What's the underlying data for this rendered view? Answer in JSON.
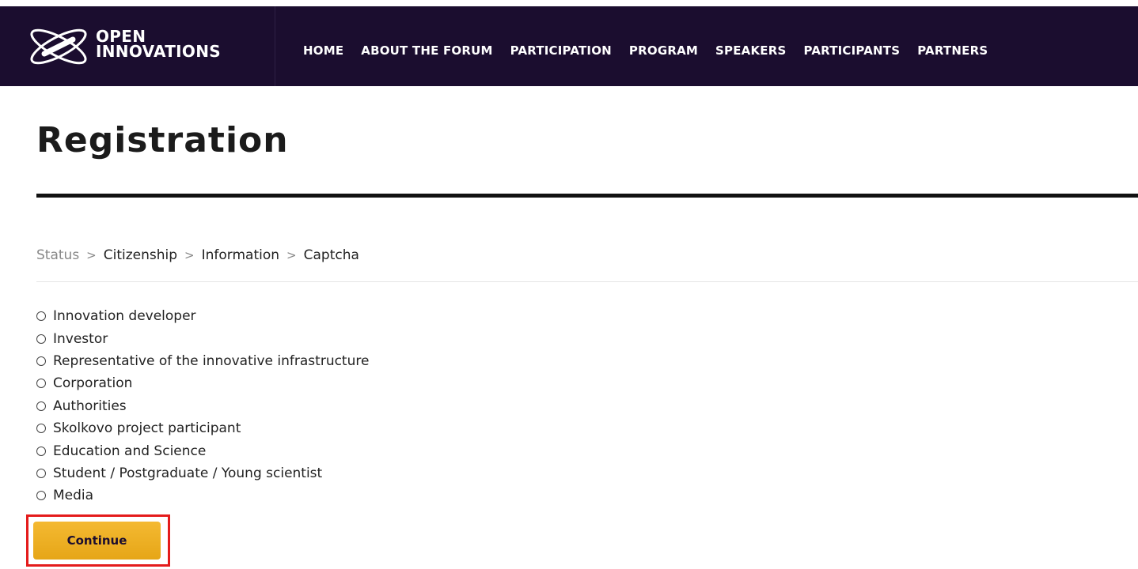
{
  "header": {
    "logo_line1": "OPEN",
    "logo_line2": "INNOVATIONS",
    "nav": [
      {
        "label": "HOME"
      },
      {
        "label": "ABOUT THE FORUM"
      },
      {
        "label": "PARTICIPATION"
      },
      {
        "label": "PROGRAM"
      },
      {
        "label": "SPEAKERS"
      },
      {
        "label": "PARTICIPANTS"
      },
      {
        "label": "PARTNERS"
      }
    ],
    "background_color": "#1b0d2f"
  },
  "page_title": "Registration",
  "breadcrumb": {
    "steps": [
      "Status",
      "Citizenship",
      "Information",
      "Captcha"
    ],
    "separator": ">"
  },
  "options": [
    {
      "label": "Innovation developer"
    },
    {
      "label": "Investor"
    },
    {
      "label": "Representative of the innovative infrastructure"
    },
    {
      "label": "Corporation"
    },
    {
      "label": "Authorities"
    },
    {
      "label": "Skolkovo project participant"
    },
    {
      "label": "Education and Science"
    },
    {
      "label": "Student / Postgraduate / Young scientist"
    },
    {
      "label": "Media"
    }
  ],
  "continue_label": "Continue",
  "accent_color": "#f0b02a",
  "highlight_color": "#e41b1b"
}
